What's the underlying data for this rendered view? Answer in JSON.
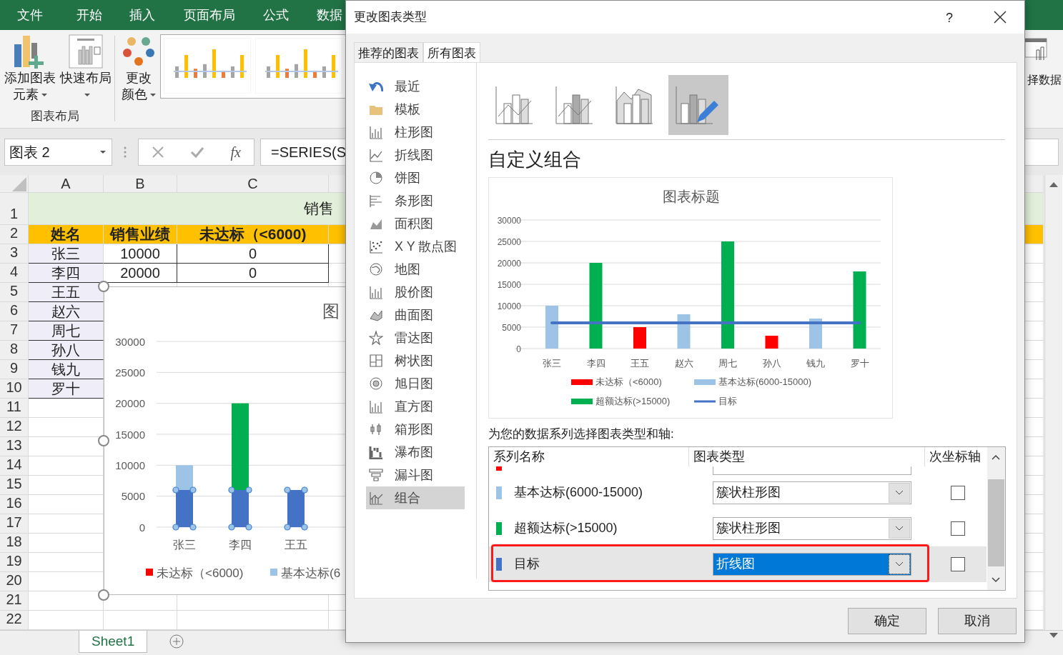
{
  "ribbon": {
    "tabs": [
      "文件",
      "开始",
      "插入",
      "页面布局",
      "公式",
      "数据"
    ],
    "buttons": [
      {
        "lines": [
          "添加图表",
          "元素"
        ],
        "dropdown": true
      },
      {
        "lines": [
          "快速布局"
        ],
        "dropdown": true
      },
      {
        "lines": [
          "更改",
          "颜色"
        ],
        "dropdown": true
      }
    ],
    "group_label": "图表布局",
    "right_label": "择数据"
  },
  "formula_bar": {
    "name_box": "图表 2",
    "fx": "fx",
    "formula": "=SERIES(S"
  },
  "sheet": {
    "columns": [
      "A",
      "B",
      "C"
    ],
    "rows": [
      "1",
      "2",
      "3",
      "4",
      "5",
      "6",
      "7",
      "8",
      "9",
      "10",
      "11",
      "12",
      "13",
      "14",
      "15",
      "16",
      "17",
      "18",
      "19",
      "20",
      "21",
      "22"
    ],
    "title": "销售",
    "headers": [
      "姓名",
      "销售业绩",
      "未达标（<6000)"
    ],
    "names": [
      "张三",
      "李四",
      "王五",
      "赵六",
      "周七",
      "孙八",
      "钱九",
      "罗十"
    ],
    "values": [
      [
        "10000",
        "0"
      ],
      [
        "20000",
        "0"
      ]
    ],
    "tab": "Sheet1"
  },
  "embedded_chart": {
    "title": "图",
    "series_selected": [
      true,
      false,
      false,
      false
    ],
    "chart_data": {
      "type": "bar",
      "stacked": true,
      "grid": true,
      "legend": true,
      "categories": [
        "张三",
        "李四",
        "王五"
      ],
      "ylim": [
        0,
        30000
      ],
      "yticks": [
        0,
        5000,
        10000,
        15000,
        20000,
        25000,
        30000
      ],
      "series": [
        {
          "color": "#4472c4",
          "values": [
            6000,
            6000,
            6000
          ]
        },
        {
          "name": "未达标（<6000)",
          "color": "#ff0000",
          "values": [
            null,
            null,
            null
          ]
        },
        {
          "name": "基本达标(6",
          "color": "#9dc3e6",
          "values": [
            4000,
            null,
            null
          ]
        },
        {
          "color": "#00b050",
          "values": [
            null,
            14000,
            null
          ]
        }
      ]
    }
  },
  "dialog": {
    "title": "更改图表类型",
    "help": "?",
    "tabs": [
      {
        "label": "推荐的图表",
        "selected": false
      },
      {
        "label": "所有图表",
        "selected": true
      }
    ],
    "chart_types": [
      {
        "label": "最近",
        "selected": false
      },
      {
        "label": "模板",
        "selected": false
      },
      {
        "label": "柱形图",
        "selected": false
      },
      {
        "label": "折线图",
        "selected": false
      },
      {
        "label": "饼图",
        "selected": false
      },
      {
        "label": "条形图",
        "selected": false
      },
      {
        "label": "面积图",
        "selected": false
      },
      {
        "label": "X Y 散点图",
        "selected": false
      },
      {
        "label": "地图",
        "selected": false
      },
      {
        "label": "股价图",
        "selected": false
      },
      {
        "label": "曲面图",
        "selected": false
      },
      {
        "label": "雷达图",
        "selected": false
      },
      {
        "label": "树状图",
        "selected": false
      },
      {
        "label": "旭日图",
        "selected": false
      },
      {
        "label": "直方图",
        "selected": false
      },
      {
        "label": "箱形图",
        "selected": false
      },
      {
        "label": "瀑布图",
        "selected": false
      },
      {
        "label": "漏斗图",
        "selected": false
      },
      {
        "label": "组合",
        "selected": true
      }
    ],
    "subtypes": [
      {
        "selected": false
      },
      {
        "selected": false
      },
      {
        "selected": false
      },
      {
        "selected": true
      }
    ],
    "heading": "自定义组合",
    "preview": {
      "chart_data": {
        "type": "bar",
        "grid": true,
        "legend": true,
        "title": "图表标题",
        "categories": [
          "张三",
          "李四",
          "王五",
          "赵六",
          "周七",
          "孙八",
          "钱九",
          "罗十"
        ],
        "ylim": [
          0,
          30000
        ],
        "yticks": [
          0,
          5000,
          10000,
          15000,
          20000,
          25000,
          30000
        ],
        "series": [
          {
            "name": "未达标（<6000)",
            "color": "#ff0000",
            "values": [
              null,
              null,
              5000,
              null,
              null,
              3000,
              null,
              null
            ]
          },
          {
            "name": "基本达标(6000-15000)",
            "color": "#9dc3e6",
            "values": [
              10000,
              null,
              null,
              8000,
              null,
              null,
              7000,
              null
            ]
          },
          {
            "name": "超额达标(>15000)",
            "color": "#00b050",
            "values": [
              null,
              20000,
              null,
              null,
              25000,
              null,
              null,
              18000
            ]
          },
          {
            "name": "目标",
            "color": "#4472c4",
            "type": "line",
            "values": [
              6000,
              6000,
              6000,
              6000,
              6000,
              6000,
              6000,
              6000
            ]
          }
        ]
      }
    },
    "prompt": "为您的数据系列选择图表类型和轴:",
    "series_table": {
      "columns": [
        "系列名称",
        "图表类型",
        "次坐标轴"
      ],
      "rows": [
        {
          "kind": "partial",
          "color": "#ff0000"
        },
        {
          "kind": "full",
          "name": "基本达标(6000-15000)",
          "color": "#9dc3e6",
          "chart_type": "簇状柱形图",
          "secondary_axis": false,
          "selected": false,
          "highlighted": false
        },
        {
          "kind": "full",
          "name": "超额达标(>15000)",
          "color": "#00b050",
          "chart_type": "簇状柱形图",
          "secondary_axis": false,
          "selected": false,
          "highlighted": false
        },
        {
          "kind": "full",
          "name": "目标",
          "color": "#4472c4",
          "chart_type": "折线图",
          "secondary_axis": false,
          "selected": true,
          "highlighted": true
        }
      ]
    },
    "buttons": [
      "确定",
      "取消"
    ]
  }
}
